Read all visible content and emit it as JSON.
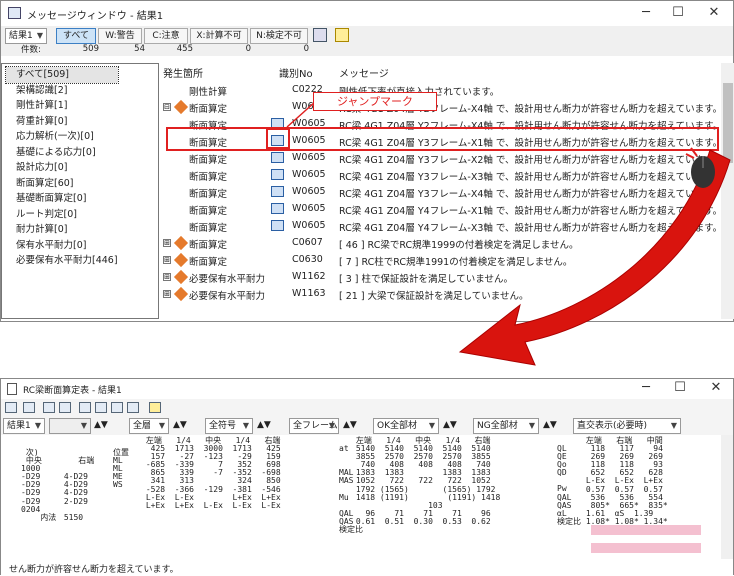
{
  "win1": {
    "title": "メッセージウィンドウ - 結果1",
    "select": "結果1",
    "filters": [
      "すべて",
      "W:警告",
      "C:注意",
      "X:計算不可",
      "N:検定不可"
    ],
    "count_label": "件数:",
    "counts": [
      "509",
      "54",
      "455",
      "0",
      "0"
    ],
    "tree": [
      "すべて[509]",
      "架構認識[2]",
      "剛性計算[1]",
      "荷重計算[0]",
      "応力解析(一次)[0]",
      "基礎による応力[0]",
      "設計応力[0]",
      "断面算定[60]",
      "基礎断面算定[0]",
      "ルート判定[0]",
      "耐力計算[0]",
      "保有水平耐力[0]",
      "必要保有水平耐力[446]"
    ],
    "headers": [
      "発生箇所",
      "識別No",
      "メッセージ"
    ],
    "rows": [
      {
        "ex": "",
        "loc": "剛性計算",
        "id": "C0222",
        "msg": "剛性低下率が直接入力されています。",
        "icon": ""
      },
      {
        "ex": "⊟",
        "loc": "断面算定",
        "id": "W0605",
        "msg": "RC梁 4G1 Z04層 Y2フレーム-X4軸 で、設計用せん断力が許容せん断力を超えています。",
        "icon": "warn"
      },
      {
        "ex": "",
        "loc": "断面算定",
        "id": "W0605",
        "msg": "RC梁 4G1 Z04層 Y2フレーム-X4軸 で、設計用せん断力が許容せん断力を超えています。",
        "icon": "jmp"
      },
      {
        "ex": "",
        "loc": "断面算定",
        "id": "W0605",
        "msg": "RC梁 4G1 Z04層 Y3フレーム-X1軸 で、設計用せん断力が許容せん断力を超えています。",
        "icon": "jmp"
      },
      {
        "ex": "",
        "loc": "断面算定",
        "id": "W0605",
        "msg": "RC梁 4G1 Z04層 Y3フレーム-X2軸 で、設計用せん断力が許容せん断力を超えています。",
        "icon": "jmp"
      },
      {
        "ex": "",
        "loc": "断面算定",
        "id": "W0605",
        "msg": "RC梁 4G1 Z04層 Y3フレーム-X3軸 で、設計用せん断力が許容せん断力を超えています。",
        "icon": "jmp"
      },
      {
        "ex": "",
        "loc": "断面算定",
        "id": "W0605",
        "msg": "RC梁 4G1 Z04層 Y3フレーム-X4軸 で、設計用せん断力が許容せん断力を超えています。",
        "icon": "jmp"
      },
      {
        "ex": "",
        "loc": "断面算定",
        "id": "W0605",
        "msg": "RC梁 4G1 Z04層 Y4フレーム-X1軸 で、設計用せん断力が許容せん断力を超えています。",
        "icon": "jmp"
      },
      {
        "ex": "",
        "loc": "断面算定",
        "id": "W0605",
        "msg": "RC梁 4G1 Z04層 Y4フレーム-X3軸 で、設計用せん断力が許容せん断力を超えています。",
        "icon": "jmp"
      },
      {
        "ex": "⊞",
        "loc": "断面算定",
        "id": "C0607",
        "msg": "[ 46 ] RC梁でRC規準1999の付着検定を満足しません。",
        "icon": "warn"
      },
      {
        "ex": "⊞",
        "loc": "断面算定",
        "id": "C0630",
        "msg": "[ 7 ] RC柱でRC規準1991の付着検定を満足しません。",
        "icon": "warn"
      },
      {
        "ex": "⊞",
        "loc": "必要保有水平耐力",
        "id": "W1162",
        "msg": "[ 3 ] 柱で保証設計を満足していません。",
        "icon": "warn"
      },
      {
        "ex": "⊞",
        "loc": "必要保有水平耐力",
        "id": "W1163",
        "msg": "[ 21 ] 大梁で保証設計を満足していません。",
        "icon": "warn"
      }
    ],
    "callout": "ジャンプマーク"
  },
  "win2": {
    "title": "RC梁断面算定表 - 結果1",
    "sel1": "結果1",
    "sel2": "全層",
    "sel3": "全符号",
    "sel4": "全フレーム",
    "sel5": "OK全部材",
    "sel6": "NG全部材",
    "sel7": "直交表示(必要時)",
    "status": "せん断力が許容せん断力を超えています。",
    "col1": " 次)\n 中央\n1000\n-D29\n-D29\n-D29\n-D29\n0204\n    内法",
    "col1b": "\n    右端\n\n 4-D29\n 4-D29\n 4-D29\n 2-D29\n\n 5150",
    "col2": "位置\nML\nML\nME\nWS",
    "col3": " 左端   1/4   中央   1/4   右端\n  425  1713  3000  1713   425\n  157   -27  -123   -29   159\n -685  -339     7   352   698\n  865   339    -7  -352  -698\n  341   313         324   850\n -528  -366  -129  -381  -546\n L-Ex  L-Ex        L+Ex  L+Ex\n L+Ex  L+Ex  L-Ex  L-Ex  L-Ex",
    "col4": "at\n\n\nMAL\nMAS\n\nMu\n\nQAL\nQAS\n検定比",
    "col5": " 左端   1/4   中央   1/4   右端\n 5140  5140  5140  5140  5140\n 3855  2570  2570  2570  3855\n  740   408   408   408   740\n 1383  1383        1383  1383\n 1052   722   722   722  1052\n 1792 (1565)       (1565) 1792\n 1418 (1191)        (1191) 1418\n                103\n   96    71    71    71    96\n 0.61  0.51  0.30  0.53  0.62",
    "col6": "QL\nQE\nQo\nQD\n\nPw\nQAL\nQAS\nαL\n検定比",
    "col7": " 左端   右端   中間\n  118   117    94\n  269   269   269\n  118   118    93\n  652   652   628\n L-Ex  L-Ex  L+Ex\n 0.57  0.57  0.57\n  536   536   554\n  805*  665*  835*\n 1.61  αS  1.39\n 1.08* 1.08* 1.34*"
  }
}
